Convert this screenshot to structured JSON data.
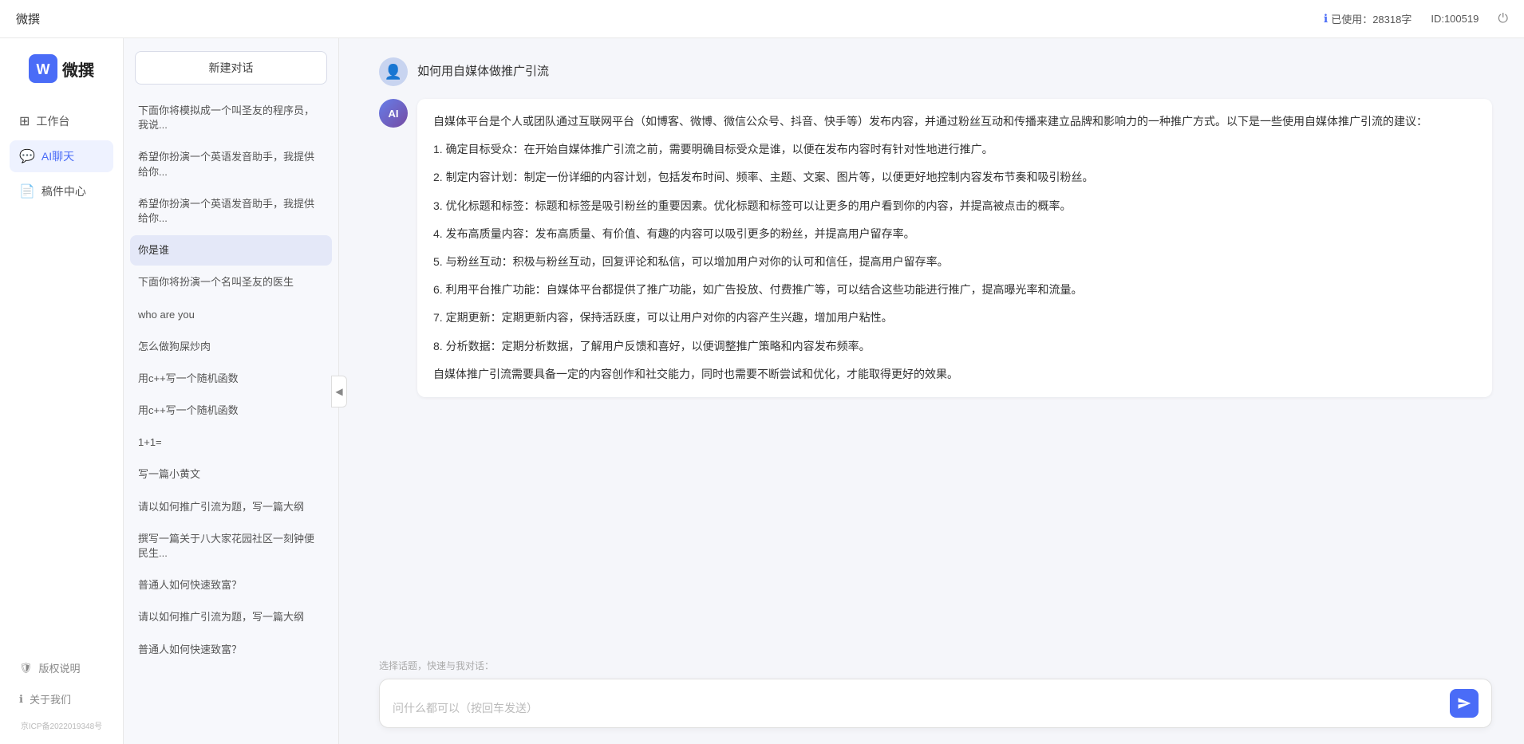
{
  "topbar": {
    "title": "微撰",
    "usage_label": "已使用：28318字",
    "id_label": "ID:100519",
    "usage_icon": "info-icon",
    "logout_icon": "power-icon"
  },
  "sidebar": {
    "logo_text": "微撰",
    "nav_items": [
      {
        "id": "workbench",
        "label": "工作台",
        "icon": "grid-icon"
      },
      {
        "id": "ai-chat",
        "label": "AI聊天",
        "icon": "chat-icon",
        "active": true
      },
      {
        "id": "drafts",
        "label": "稿件中心",
        "icon": "doc-icon"
      }
    ],
    "bottom_items": [
      {
        "id": "copyright",
        "label": "版权说明",
        "icon": "shield-icon"
      },
      {
        "id": "about",
        "label": "关于我们",
        "icon": "info-circle-icon"
      }
    ],
    "icp": "京ICP备2022019348号"
  },
  "history": {
    "new_chat_label": "新建对话",
    "items": [
      {
        "id": 1,
        "text": "下面你将模拟成一个叫圣友的程序员，我说..."
      },
      {
        "id": 2,
        "text": "希望你扮演一个英语发音助手，我提供给你..."
      },
      {
        "id": 3,
        "text": "希望你扮演一个英语发音助手，我提供给你..."
      },
      {
        "id": 4,
        "text": "你是谁",
        "active": true
      },
      {
        "id": 5,
        "text": "下面你将扮演一个名叫圣友的医生"
      },
      {
        "id": 6,
        "text": "who are you"
      },
      {
        "id": 7,
        "text": "怎么做狗屎炒肉"
      },
      {
        "id": 8,
        "text": "用c++写一个随机函数"
      },
      {
        "id": 9,
        "text": "用c++写一个随机函数"
      },
      {
        "id": 10,
        "text": "1+1="
      },
      {
        "id": 11,
        "text": "写一篇小黄文"
      },
      {
        "id": 12,
        "text": "请以如何推广引流为题，写一篇大纲"
      },
      {
        "id": 13,
        "text": "撰写一篇关于八大家花园社区一刻钟便民生..."
      },
      {
        "id": 14,
        "text": "普通人如何快速致富？"
      },
      {
        "id": 15,
        "text": "请以如何推广引流为题，写一篇大纲"
      },
      {
        "id": 16,
        "text": "普通人如何快速致富？"
      }
    ]
  },
  "chat": {
    "user_message": "如何用自媒体做推广引流",
    "ai_response": {
      "paragraphs": [
        "自媒体平台是个人或团队通过互联网平台（如博客、微博、微信公众号、抖音、快手等）发布内容，并通过粉丝互动和传播来建立品牌和影响力的一种推广方式。以下是一些使用自媒体推广引流的建议：",
        "1. 确定目标受众：在开始自媒体推广引流之前，需要明确目标受众是谁，以便在发布内容时有针对性地进行推广。",
        "2. 制定内容计划：制定一份详细的内容计划，包括发布时间、频率、主题、文案、图片等，以便更好地控制内容发布节奏和吸引粉丝。",
        "3. 优化标题和标签：标题和标签是吸引粉丝的重要因素。优化标题和标签可以让更多的用户看到你的内容，并提高被点击的概率。",
        "4. 发布高质量内容：发布高质量、有价值、有趣的内容可以吸引更多的粉丝，并提高用户留存率。",
        "5. 与粉丝互动：积极与粉丝互动，回复评论和私信，可以增加用户对你的认可和信任，提高用户留存率。",
        "6. 利用平台推广功能：自媒体平台都提供了推广功能，如广告投放、付费推广等，可以结合这些功能进行推广，提高曝光率和流量。",
        "7. 定期更新：定期更新内容，保持活跃度，可以让用户对你的内容产生兴趣，增加用户粘性。",
        "8. 分析数据：定期分析数据，了解用户反馈和喜好，以便调整推广策略和内容发布频率。",
        "自媒体推广引流需要具备一定的内容创作和社交能力，同时也需要不断尝试和优化，才能取得更好的效果。"
      ]
    },
    "quick_topics_label": "选择话题，快速与我对话：",
    "input_placeholder": "问什么都可以（按回车发送）"
  }
}
